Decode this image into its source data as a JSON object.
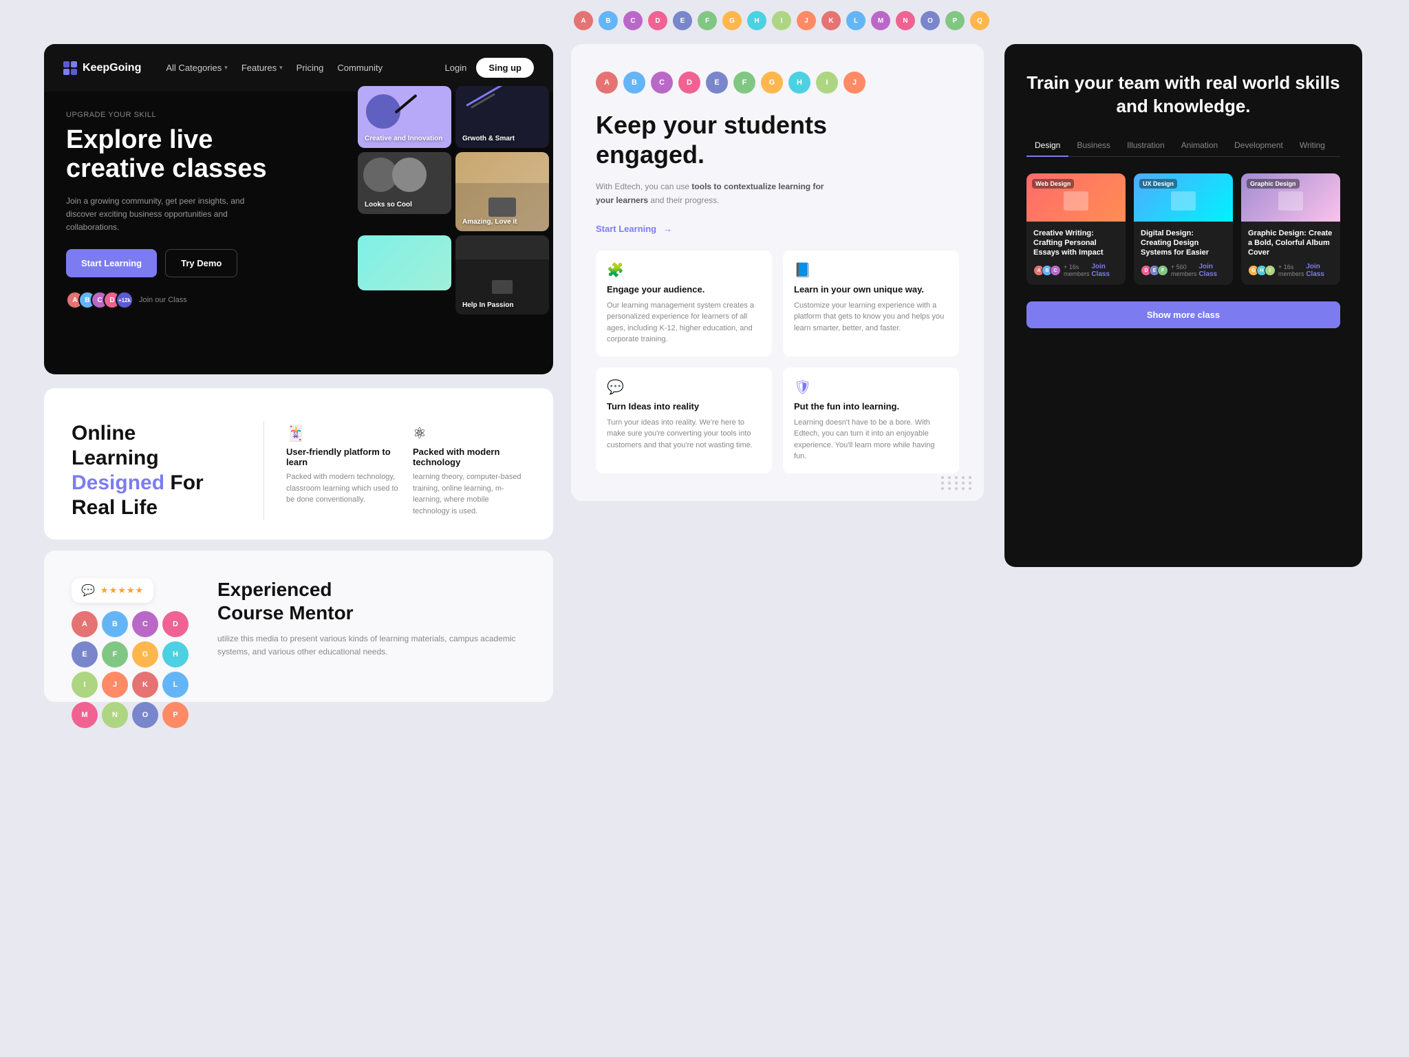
{
  "brand": {
    "name": "KeepGoing",
    "logo_alt": "KeepGoing logo"
  },
  "navbar": {
    "links": [
      {
        "label": "All Categories",
        "has_dropdown": true
      },
      {
        "label": "Features",
        "has_dropdown": true
      },
      {
        "label": "Pricing",
        "has_dropdown": false
      },
      {
        "label": "Community",
        "has_dropdown": false
      }
    ],
    "login_label": "Login",
    "signup_label": "Sing up"
  },
  "hero": {
    "badge": "UPGRADE YOUR SKILL",
    "title_line1": "Explore live",
    "title_line2": "creative classes",
    "description": "Join a growing community, get peer insights, and discover exciting business opportunities and collaborations.",
    "cta_primary": "Start Learning",
    "cta_secondary": "Try Demo",
    "join_text": "Join our Class",
    "student_count": "+12k"
  },
  "cards": [
    {
      "label": "Creative and Innovation",
      "color": "purple"
    },
    {
      "label": "Grwoth & Smart",
      "color": "dark"
    },
    {
      "label": "Looks so Cool",
      "color": "gray"
    },
    {
      "label": "Amazing, Love it",
      "color": "beige"
    },
    {
      "label": "Help In Passion",
      "color": "dark2"
    },
    {
      "label": "",
      "color": "cyan"
    }
  ],
  "online_learning": {
    "title_line1": "Online",
    "title_line2": "Learning",
    "title_accent": "Designed",
    "title_line3": "For",
    "title_line4": "Real Life",
    "features": [
      {
        "icon": "🃏",
        "title": "User-friendly platform to learn",
        "desc": "Packed with modern technology, classroom learning which used to be done conventionally."
      },
      {
        "icon": "⚛",
        "title": "Packed with modern technology",
        "desc": "learning theory, computer-based training, online learning, m-learning, where mobile technology is used."
      }
    ]
  },
  "mentor": {
    "rating_icon": "💬",
    "stars": "★★★★★",
    "title_line1": "Experienced",
    "title_line2": "Course Mentor",
    "desc": "utilize this media to present various kinds of learning materials, campus academic systems, and various other educational needs."
  },
  "right_section": {
    "title_line1": "Keep your students",
    "title_line2": "engaged.",
    "desc_part1": "With Edtech, you can use",
    "desc_part2": "tools to contextualize learning for your learners",
    "desc_part3": "and their progress.",
    "cta_text": "Start Learning",
    "features": [
      {
        "icon": "🧩",
        "title": "Engage your audience.",
        "desc": "Our learning management system creates a personalized experience for learners of all ages, including K-12, higher education, and corporate training."
      },
      {
        "icon": "📘",
        "title": "Learn in your own unique way.",
        "desc": "Customize your learning experience with a platform that gets to know you and helps you learn smarter, better, and faster."
      },
      {
        "icon": "💬",
        "title": "Turn Ideas into reality",
        "desc": "Turn your ideas into reality. We're here to make sure you're converting your tools into customers and that you're not wasting time."
      },
      {
        "icon": "🛡",
        "title": "Put the fun into learning.",
        "desc": "Learning doesn't have to be a bore. With Edtech, you can turn it into an enjoyable experience. You'll learn more while having fun."
      }
    ]
  },
  "train_section": {
    "title": "Train your team with real world skills and knowledge.",
    "tabs": [
      "Design",
      "Business",
      "Illustration",
      "Animation",
      "Development",
      "Writing"
    ],
    "active_tab": "Design",
    "courses": [
      {
        "category": "Web Design",
        "title": "Creative Writing: Crafting Personal Essays with Impact",
        "members_label": "+ 16s members",
        "join_label": "Join Class",
        "bg": "bg-red"
      },
      {
        "category": "UX Design",
        "title": "Digital Design: Creating Design Systems for Easier",
        "members_label": "+ 560 members",
        "join_label": "Join Class",
        "bg": "bg-blue"
      },
      {
        "category": "Graphic Design",
        "title": "Graphic Design: Create a Bold, Colorful Album Cover",
        "members_label": "+ 16s members",
        "join_label": "Join Class",
        "bg": "bg-purple2"
      }
    ],
    "show_more_label": "Show more class"
  },
  "avatars": {
    "colors": [
      "av-1",
      "av-2",
      "av-3",
      "av-4",
      "av-5",
      "av-6",
      "av-7",
      "av-8",
      "av-9",
      "av-10"
    ]
  }
}
